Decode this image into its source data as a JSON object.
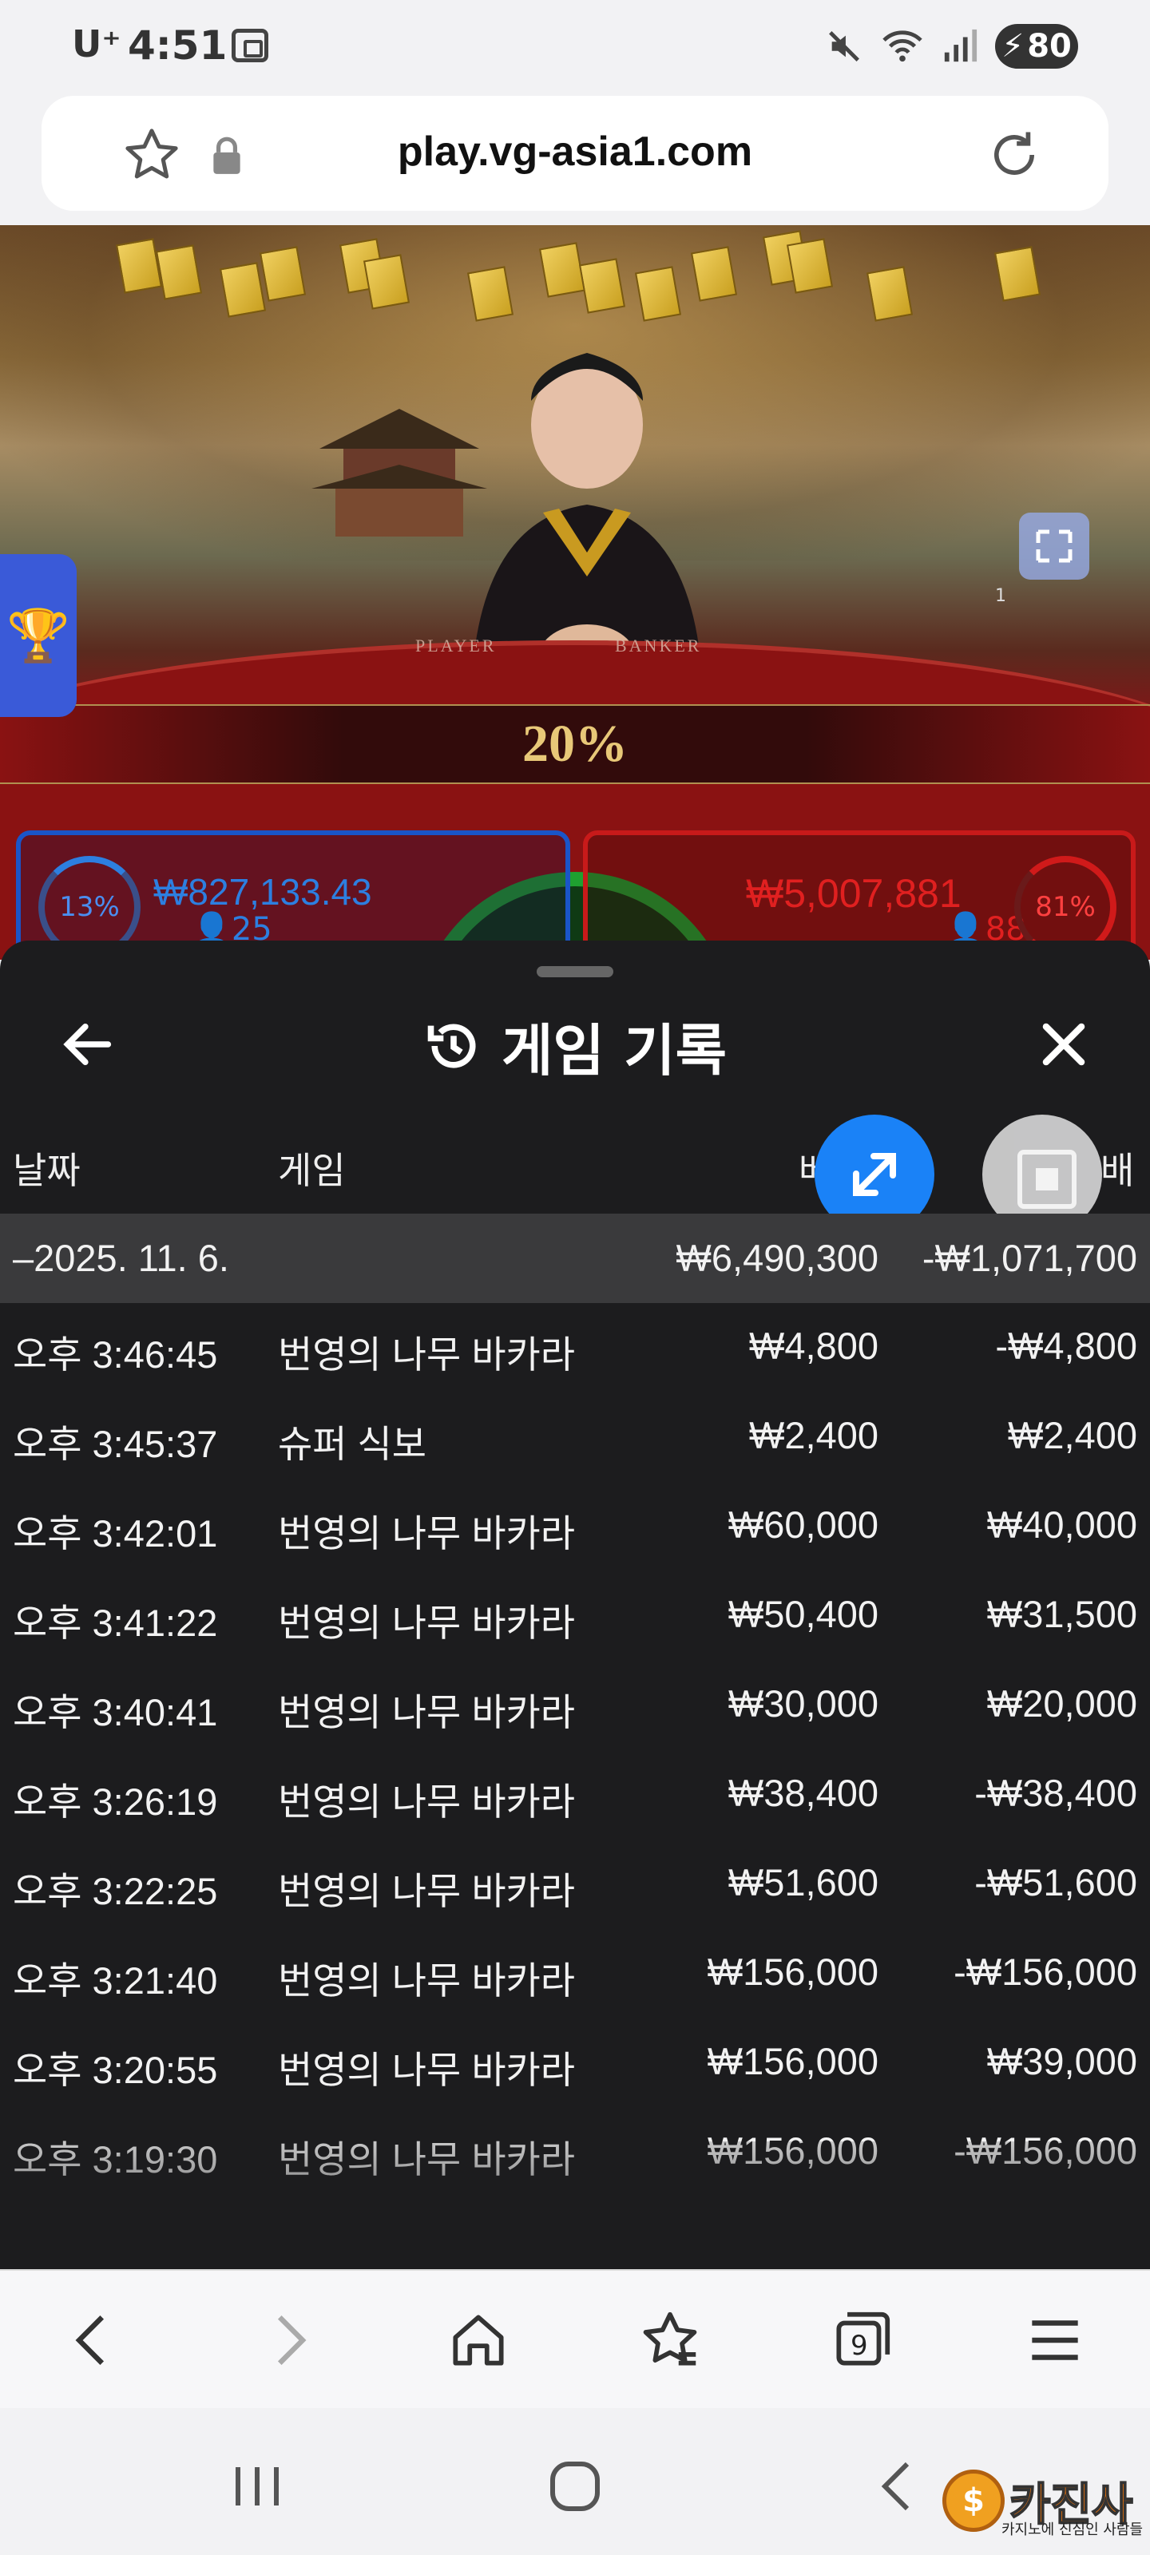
{
  "status_bar": {
    "carrier": "U⁺",
    "time": "4:51",
    "battery": "80"
  },
  "browser": {
    "url": "play.vg-asia1.com"
  },
  "game": {
    "felt_player": "PLAYER",
    "felt_banker": "BANKER",
    "ratio": "20%",
    "player_pct": "13%",
    "player_amount": "₩827,133.43",
    "player_count": "25",
    "banker_pct": "81%",
    "banker_amount": "₩5,007,881",
    "banker_count": "88",
    "fullscreen_count": "1"
  },
  "sheet": {
    "title": "게임 기록",
    "columns": {
      "date": "날짜",
      "game": "게임",
      "bet": "베",
      "payout": "배"
    },
    "date_group": {
      "date": "–2025. 11. 6.",
      "bet_total": "₩6,490,300",
      "payout_total": "-₩1,071,700"
    },
    "rows": [
      {
        "time": "오후 3:46:45",
        "game": "번영의 나무 바카라",
        "bet": "₩4,800",
        "payout": "-₩4,800"
      },
      {
        "time": "오후 3:45:37",
        "game": "슈퍼 식보",
        "bet": "₩2,400",
        "payout": "₩2,400"
      },
      {
        "time": "오후 3:42:01",
        "game": "번영의 나무 바카라",
        "bet": "₩60,000",
        "payout": "₩40,000"
      },
      {
        "time": "오후 3:41:22",
        "game": "번영의 나무 바카라",
        "bet": "₩50,400",
        "payout": "₩31,500"
      },
      {
        "time": "오후 3:40:41",
        "game": "번영의 나무 바카라",
        "bet": "₩30,000",
        "payout": "₩20,000"
      },
      {
        "time": "오후 3:26:19",
        "game": "번영의 나무 바카라",
        "bet": "₩38,400",
        "payout": "-₩38,400"
      },
      {
        "time": "오후 3:22:25",
        "game": "번영의 나무 바카라",
        "bet": "₩51,600",
        "payout": "-₩51,600"
      },
      {
        "time": "오후 3:21:40",
        "game": "번영의 나무 바카라",
        "bet": "₩156,000",
        "payout": "-₩156,000"
      },
      {
        "time": "오후 3:20:55",
        "game": "번영의 나무 바카라",
        "bet": "₩156,000",
        "payout": "₩39,000"
      },
      {
        "time": "오후 3:19:30",
        "game": "번영의 나무 바카라",
        "bet": "₩156,000",
        "payout": "-₩156,000"
      }
    ]
  },
  "toolbar": {
    "tabs_count": "9"
  },
  "watermark": {
    "logo_text": "카진사",
    "coin": "$",
    "tagline": "카지노에 진심인 사람들"
  }
}
